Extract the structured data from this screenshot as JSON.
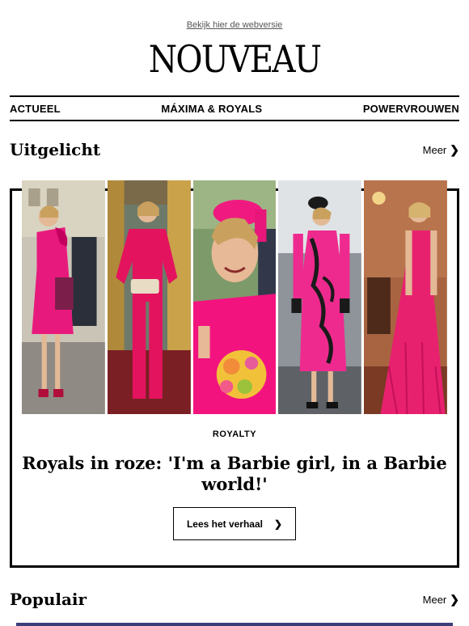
{
  "header": {
    "webversion_link": "Bekijk hier de webversie",
    "logo_text": "NOUVEAU"
  },
  "nav": {
    "items": [
      {
        "label": "ACTUEEL"
      },
      {
        "label": "MÁXIMA & ROYALS"
      },
      {
        "label": "POWERVROUWEN"
      }
    ]
  },
  "featured": {
    "section_title": "Uitgelicht",
    "more_label": "Meer",
    "chevron": "❯",
    "category": "ROYALTY",
    "headline": "Royals in roze: 'I'm a Barbie girl, in a Barbie world!'",
    "cta_label": "Lees het verhaal",
    "photo_names": [
      "one-shoulder-pink-dress",
      "pink-pantsuit",
      "pink-hat-closeup",
      "pink-embroidered-dress",
      "pink-gown"
    ],
    "colors": {
      "pink": "#e8197d",
      "magenta": "#d4006e",
      "border": "#000000"
    }
  },
  "popular": {
    "section_title": "Populair",
    "more_label": "Meer",
    "chevron": "❯"
  }
}
